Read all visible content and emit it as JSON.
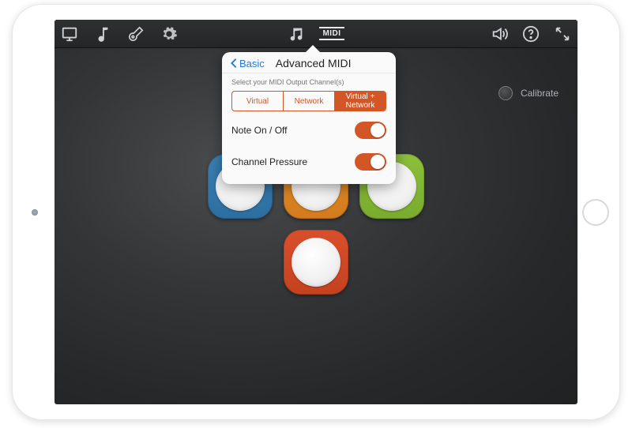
{
  "toolbar": {
    "icons_left": [
      "monitor-icon",
      "note-icon",
      "guitar-icon",
      "gear-icon"
    ],
    "icons_center": [
      "music-notes-icon",
      "midi-icon"
    ],
    "midi_label": "MIDI",
    "icons_right": [
      "volume-icon",
      "help-icon",
      "fullscreen-icon"
    ]
  },
  "popover": {
    "back_label": "Basic",
    "title": "Advanced MIDI",
    "subtitle": "Select your MIDI Output Channel(s)",
    "segments": [
      {
        "label": "Virtual",
        "active": false
      },
      {
        "label": "Network",
        "active": false
      },
      {
        "label": "Virtual + Network",
        "active": true
      }
    ],
    "settings": [
      {
        "label": "Note On / Off",
        "on": true
      },
      {
        "label": "Channel Pressure",
        "on": true
      }
    ]
  },
  "calibrate": {
    "label": "Calibrate"
  },
  "pads": {
    "row1": [
      {
        "color": "blue"
      },
      {
        "color": "orange"
      },
      {
        "color": "green"
      }
    ],
    "row2": [
      {
        "color": "red"
      }
    ]
  },
  "colors": {
    "accent": "#d35627",
    "link": "#2678d6"
  }
}
